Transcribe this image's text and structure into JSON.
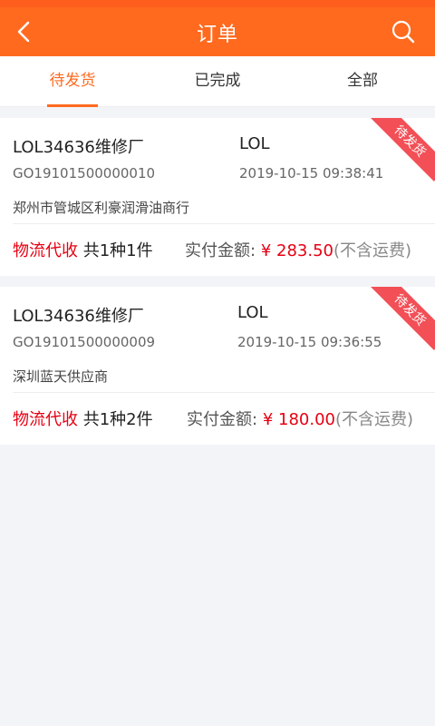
{
  "header": {
    "title": "订单",
    "back_icon": "chevron-left-icon",
    "search_icon": "search-icon",
    "bg_color": "#ff6a1f"
  },
  "tabs": [
    {
      "label": "待发货",
      "active": true
    },
    {
      "label": "已完成",
      "active": false
    },
    {
      "label": "全部",
      "active": false
    }
  ],
  "orders": [
    {
      "shop": "LOL34636维修厂",
      "user": "LOL",
      "order_no": "GO19101500000010",
      "time": "2019-10-15 09:38:41",
      "supplier": "郑州市管城区利豪润滑油商行",
      "ribbon": "待发货",
      "delivery": "物流代收",
      "count": "共1种1件",
      "amount_label": "实付金额:",
      "amount": "¥ 283.50",
      "shipping_note": "(不含运费)"
    },
    {
      "shop": "LOL34636维修厂",
      "user": "LOL",
      "order_no": "GO19101500000009",
      "time": "2019-10-15 09:36:55",
      "supplier": "深圳蓝天供应商",
      "ribbon": "待发货",
      "delivery": "物流代收",
      "count": "共1种2件",
      "amount_label": "实付金额:",
      "amount": "¥ 180.00",
      "shipping_note": "(不含运费)"
    }
  ]
}
